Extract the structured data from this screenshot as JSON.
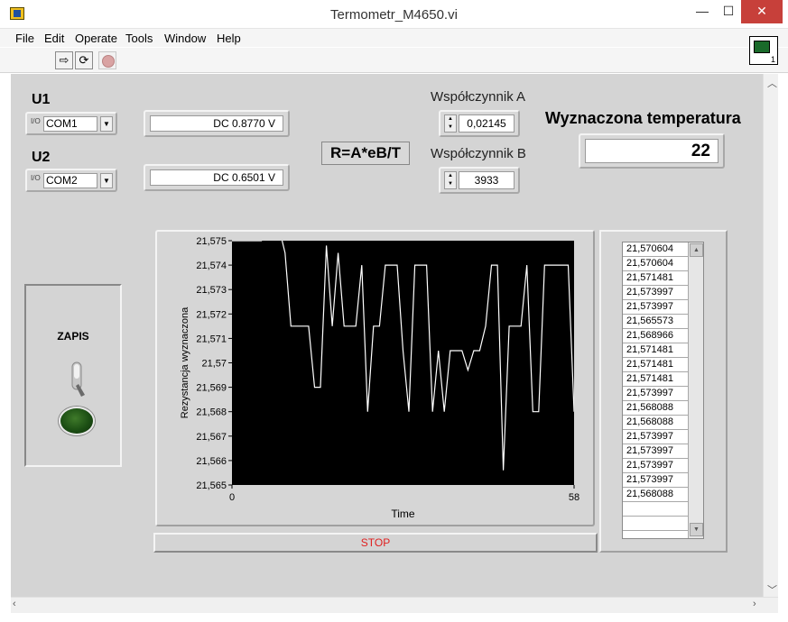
{
  "window": {
    "title": "Termometr_M4650.vi",
    "minimize": "—",
    "maximize": "☐",
    "close": "✕"
  },
  "menu": [
    "File",
    "Edit",
    "Operate",
    "Tools",
    "Window",
    "Help"
  ],
  "toolbar": {
    "run_icon": "run-arrow-icon",
    "run_cont_icon": "run-continuously-icon",
    "abort_icon": "abort-icon"
  },
  "u1": {
    "label": "U1",
    "port": "COM1",
    "io": "I/O",
    "reading": "DC 0.8770 V"
  },
  "u2": {
    "label": "U2",
    "port": "COM2",
    "io": "I/O",
    "reading": "DC 0.6501 V"
  },
  "formula": "R=A*eB/T",
  "coef_a": {
    "label": "Współczynnik A",
    "value": "0,02145"
  },
  "coef_b": {
    "label": "Współczynnik B",
    "value": "3933"
  },
  "temperature": {
    "label": "Wyznaczona temperatura",
    "value": "22"
  },
  "zapis": {
    "label": "ZAPIS"
  },
  "stop_button": "STOP",
  "table": {
    "values": [
      "21,570604",
      "21,570604",
      "21,571481",
      "21,573997",
      "21,573997",
      "21,565573",
      "21,568966",
      "21,571481",
      "21,571481",
      "21,571481",
      "21,573997",
      "21,568088",
      "21,568088",
      "21,573997",
      "21,573997",
      "21,573997",
      "21,573997",
      "21,568088"
    ]
  },
  "chart_data": {
    "type": "line",
    "xlabel": "Time",
    "ylabel": "Rezystancja wyznaczona",
    "xlim": [
      0,
      58
    ],
    "ylim": [
      21.565,
      21.575
    ],
    "x_ticks": [
      "0",
      "58"
    ],
    "y_ticks": [
      "21,575",
      "21,574",
      "21,573",
      "21,572",
      "21,571",
      "21,57",
      "21,569",
      "21,568",
      "21,567",
      "21,566",
      "21,565"
    ],
    "background": "#000000",
    "line_color": "#ffffff",
    "grid": false,
    "series": [
      {
        "x": [
          0,
          1,
          2,
          3,
          4,
          5,
          6,
          7,
          8,
          9,
          10,
          11,
          12,
          13,
          14,
          15,
          16,
          17,
          18,
          19,
          20,
          21,
          22,
          23,
          24,
          25,
          26,
          27,
          28,
          29,
          30,
          31,
          32,
          33,
          34,
          35,
          36,
          37,
          38,
          39,
          40,
          41,
          42,
          43,
          44,
          45,
          46,
          47,
          48,
          49,
          50,
          51,
          52,
          53,
          54,
          55,
          56,
          57,
          58
        ],
        "y": [
          21.575,
          21.575,
          21.575,
          21.575,
          21.575,
          21.575,
          21.5755,
          21.5755,
          21.5755,
          21.5745,
          21.5715,
          21.5715,
          21.5715,
          21.5715,
          21.569,
          21.569,
          21.5748,
          21.5715,
          21.5745,
          21.5715,
          21.5715,
          21.5715,
          21.574,
          21.568,
          21.5715,
          21.5715,
          21.574,
          21.574,
          21.574,
          21.5705,
          21.568,
          21.574,
          21.574,
          21.574,
          21.568,
          21.5705,
          21.568,
          21.5705,
          21.5705,
          21.5705,
          21.5697,
          21.5705,
          21.5705,
          21.5715,
          21.574,
          21.574,
          21.5656,
          21.5715,
          21.5715,
          21.5715,
          21.574,
          21.568,
          21.568,
          21.574,
          21.574,
          21.574,
          21.574,
          21.574,
          21.568
        ]
      }
    ]
  }
}
